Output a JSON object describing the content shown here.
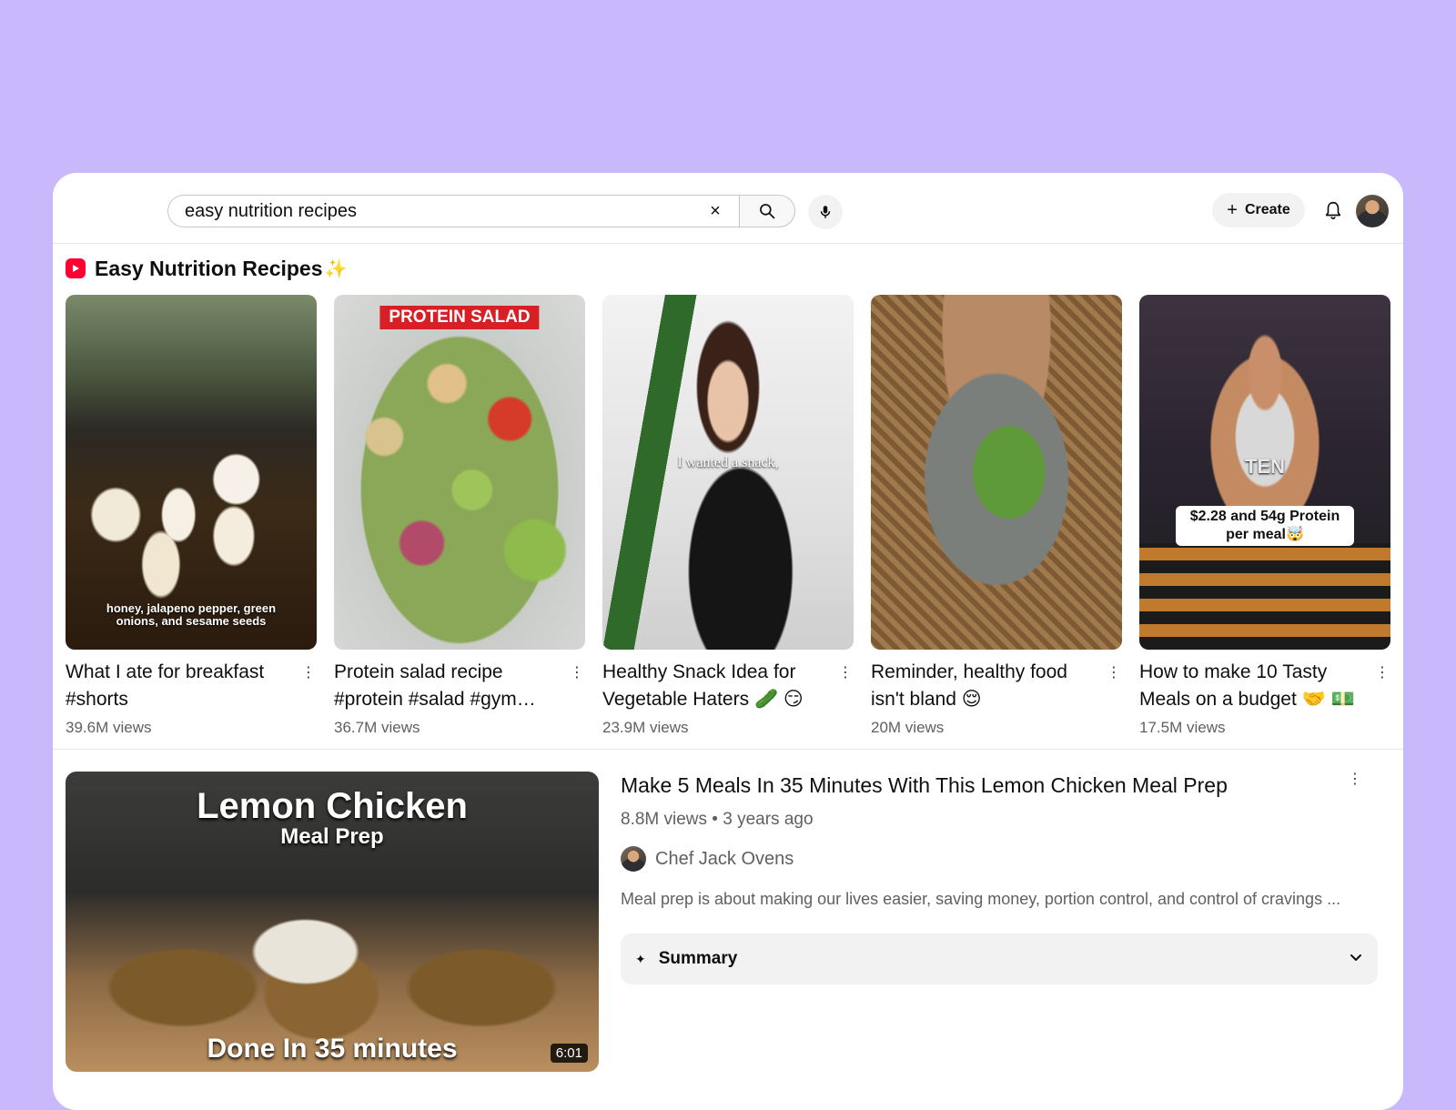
{
  "search": {
    "query": "easy nutrition recipes",
    "clear_glyph": "×"
  },
  "header": {
    "create_label": "Create",
    "create_glyph": "+"
  },
  "shorts_section": {
    "title": "Easy Nutrition Recipes",
    "title_emoji": "✨",
    "items": [
      {
        "title": "What I ate for breakfast #shorts",
        "views": "39.6M views",
        "thumb_caption": "honey, jalapeno pepper, green onions, and sesame seeds"
      },
      {
        "title": "Protein salad recipe #protein #salad #gym…",
        "views": "36.7M views",
        "thumb_caption": "PROTEIN SALAD"
      },
      {
        "title": "Healthy Snack Idea for Vegetable Haters 🥒 😏 …",
        "views": "23.9M views",
        "thumb_caption": "I wanted a snack,"
      },
      {
        "title": "Reminder, healthy food isn't bland 😌",
        "views": "20M views",
        "thumb_caption": ""
      },
      {
        "title": "How to make 10 Tasty Meals on a budget 🤝 💵",
        "views": "17.5M views",
        "thumb_caption": "$2.28 and 54g Protein per meal🤯",
        "thumb_badge": "TEN"
      }
    ]
  },
  "video": {
    "title": "Make 5 Meals In 35 Minutes With This Lemon Chicken Meal Prep",
    "meta": "8.8M views • 3 years ago",
    "channel": "Chef Jack Ovens",
    "description": "Meal prep is about making our lives easier, saving money, portion control, and control of cravings ...",
    "duration": "6:01",
    "thumb_title_main": "Lemon Chicken",
    "thumb_title_sub": "Meal Prep",
    "thumb_title_bottom": "Done In 35 minutes",
    "summary_label": "Summary"
  },
  "icons": {
    "more": "more-vertical-icon",
    "search": "search-icon",
    "mic": "mic-icon",
    "bell": "bell-icon",
    "chevron": "chevron-down-icon"
  },
  "colors": {
    "page_background": "#c9b8fb",
    "shorts_red": "#ff0033",
    "protein_banner": "#d71f25"
  }
}
